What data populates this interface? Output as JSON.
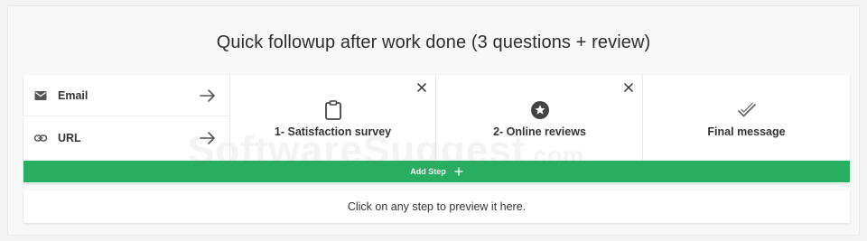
{
  "page": {
    "title": "Quick followup after work done (3 questions + review)"
  },
  "channels": [
    {
      "label": "Email",
      "icon": "mail-icon"
    },
    {
      "label": "URL",
      "icon": "link-icon"
    }
  ],
  "steps": [
    {
      "label": "1- Satisfaction survey",
      "icon": "clipboard-icon",
      "removable": true
    },
    {
      "label": "2- Online reviews",
      "icon": "star-badge-icon",
      "removable": true
    },
    {
      "label": "Final message",
      "icon": "checkmark-icon",
      "removable": false
    }
  ],
  "add_step": {
    "label": "Add Step"
  },
  "preview": {
    "hint": "Click on any step to preview it here."
  },
  "watermark": {
    "main": "SoftwareSuggest",
    "suffix": ".com"
  },
  "colors": {
    "accent_green": "#27ae60",
    "background": "#f2f3f3",
    "icon_gray": "#555555"
  }
}
